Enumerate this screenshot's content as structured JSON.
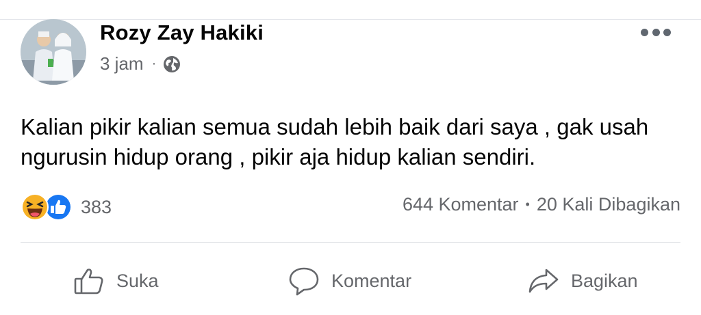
{
  "post": {
    "author": "Rozy Zay Hakiki",
    "time": "3 jam",
    "meta_separator": "·",
    "privacy_icon": "globe-icon",
    "body_text": "Kalian pikir kalian semua sudah lebih baik dari saya , gak usah ngurusin hidup orang , pikir aja hidup kalian sendiri."
  },
  "reactions": {
    "icons": [
      "haha-icon",
      "like-icon"
    ],
    "count": "383"
  },
  "stats": {
    "comments": "644 Komentar",
    "separator": "•",
    "shares": "20 Kali Dibagikan"
  },
  "actions": {
    "like": "Suka",
    "comment": "Komentar",
    "share": "Bagikan"
  },
  "colors": {
    "text_primary": "#050505",
    "text_secondary": "#65676b",
    "like_blue": "#1877f2",
    "haha_yellow": "#f7b125"
  }
}
